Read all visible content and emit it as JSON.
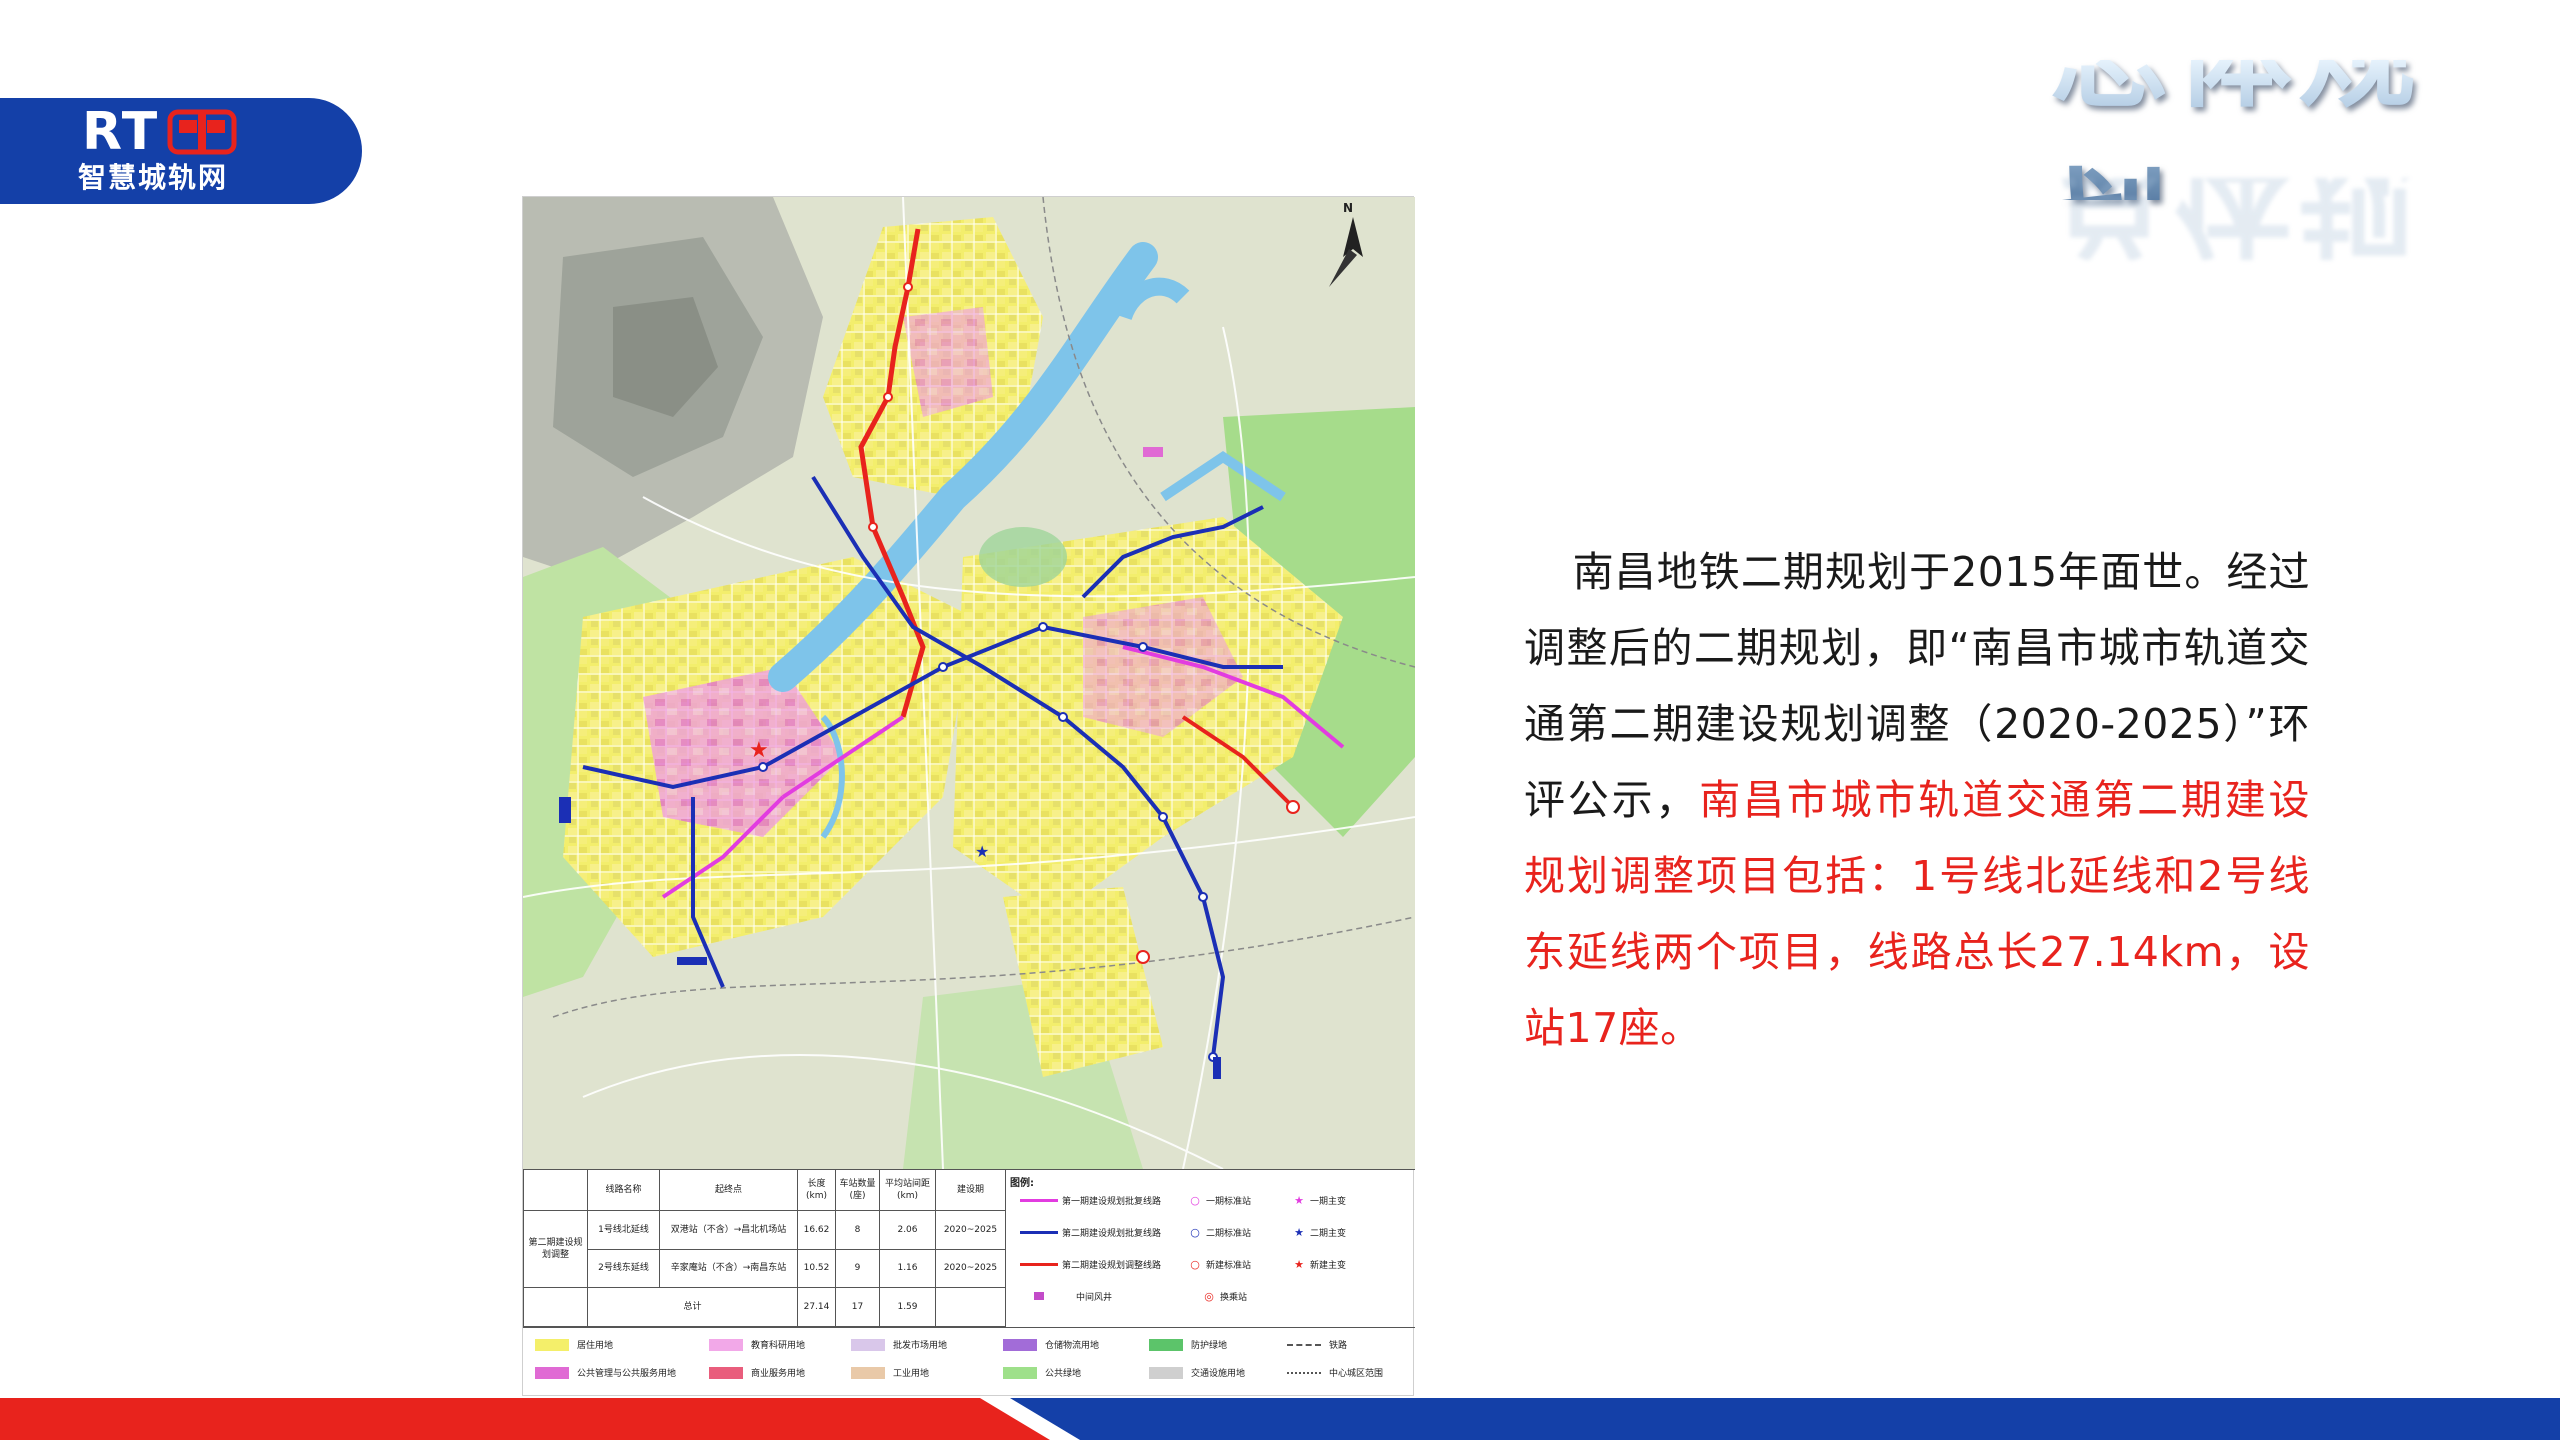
{
  "logo": {
    "brand": "RT",
    "subtitle": "智慧城轨网"
  },
  "header": {
    "title": "总体规划"
  },
  "body": {
    "paragraph_black": "南昌地铁二期规划于2015年面世。经过调整后的二期规划，即“南昌市城市轨道交通第二期建设规划调整（2020-2025）”环评公示，",
    "paragraph_red": "南昌市城市轨道交通第二期建设规划调整项目包括：1号线北延线和2号线东延线两个项目，线路总长27.14km，设站17座。"
  },
  "figure": {
    "compass": "N",
    "table": {
      "headers": [
        "",
        "线路名称",
        "起终点",
        "长度(km)",
        "车站数量(座)",
        "平均站间距(km)",
        "建设期"
      ],
      "group_label": "第二期建设规划调整",
      "rows": [
        [
          "1号线北延线",
          "双港站（不含）→昌北机场站",
          "16.62",
          "8",
          "2.06",
          "2020~2025"
        ],
        [
          "2号线东延线",
          "辛家庵站（不含）→南昌东站",
          "10.52",
          "9",
          "1.16",
          "2020~2025"
        ]
      ],
      "total": [
        "总计",
        "27.14",
        "17",
        "1.59"
      ]
    },
    "line_legend": {
      "heading": "图例:",
      "lines": [
        {
          "label": "第一期建设规划批复线路",
          "color": "#e23ce0"
        },
        {
          "label": "第二期建设规划批复线路",
          "color": "#1b2fb5"
        },
        {
          "label": "第二期建设规划调整线路",
          "color": "#e8231d"
        },
        {
          "label": "中间风井",
          "color": "#c34bc9"
        }
      ],
      "symbols": [
        {
          "label": "一期标准站",
          "glyph": "○",
          "color": "#e23ce0"
        },
        {
          "label": "二期标准站",
          "glyph": "○",
          "color": "#1b2fb5"
        },
        {
          "label": "新建标准站",
          "glyph": "○",
          "color": "#e8231d"
        },
        {
          "label": "换乘站",
          "glyph": "◎",
          "color": "#e8231d"
        }
      ],
      "stars": [
        {
          "label": "一期主变",
          "glyph": "★",
          "color": "#e23ce0"
        },
        {
          "label": "二期主变",
          "glyph": "★",
          "color": "#1b2fb5"
        },
        {
          "label": "新建主变",
          "glyph": "★",
          "color": "#e8231d"
        }
      ]
    },
    "landuse_legend": [
      {
        "label": "居住用地",
        "color": "#f4ef6a"
      },
      {
        "label": "教育科研用地",
        "color": "#f2a8e8"
      },
      {
        "label": "批发市场用地",
        "color": "#d9c7ea"
      },
      {
        "label": "仓储物流用地",
        "color": "#a26cd8"
      },
      {
        "label": "防护绿地",
        "color": "#5cc46a"
      },
      {
        "label": "铁路",
        "color": "#555555"
      },
      {
        "label": "公共管理与公共服务用地",
        "color": "#e06ad4"
      },
      {
        "label": "商业服务用地",
        "color": "#e95d7c"
      },
      {
        "label": "工业用地",
        "color": "#e9c9a8"
      },
      {
        "label": "公共绿地",
        "color": "#9ee08a"
      },
      {
        "label": "交通设施用地",
        "color": "#cfcfcf"
      },
      {
        "label": "中心城区范围",
        "color": "#555555"
      }
    ]
  },
  "colors": {
    "brand_blue": "#1440a8",
    "accent_red": "#e8231d",
    "text": "#1a1a1a"
  }
}
